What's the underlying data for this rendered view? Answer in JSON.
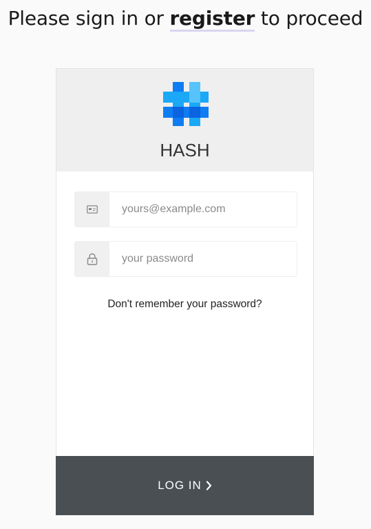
{
  "heading": {
    "before": "Please sign in or ",
    "link": "register",
    "after": " to proceed"
  },
  "brand": {
    "name": "HASH",
    "logo_colors": [
      "#0e7cf2",
      "#1aa8f7",
      "#56c3fb"
    ]
  },
  "form": {
    "email_placeholder": "yours@example.com",
    "password_placeholder": "your password",
    "forgot_label": "Don't remember your password?"
  },
  "actions": {
    "login_label": "LOG IN"
  },
  "icons": {
    "email": "id-card-icon",
    "password": "lock-icon",
    "login": "chevron-right-icon"
  },
  "colors": {
    "button_bg": "#4a4f53",
    "header_bg": "#efefef",
    "link_underline": "#d9d4ef"
  }
}
